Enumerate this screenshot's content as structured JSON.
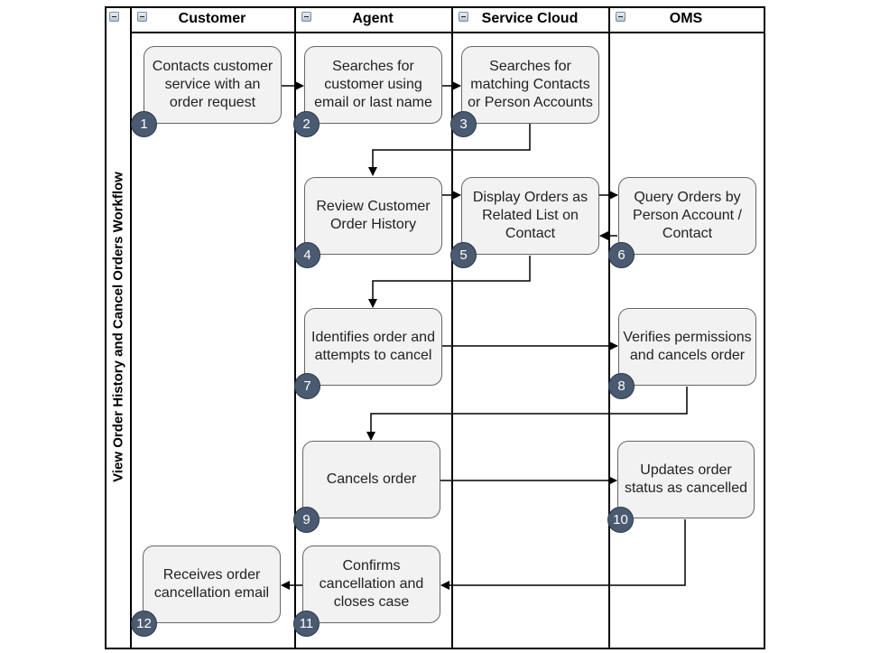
{
  "pool": {
    "title": "View Order History and Cancel Orders Workflow"
  },
  "lanes": [
    {
      "id": "customer",
      "label": "Customer"
    },
    {
      "id": "agent",
      "label": "Agent"
    },
    {
      "id": "service-cloud",
      "label": "Service Cloud"
    },
    {
      "id": "oms",
      "label": "OMS"
    }
  ],
  "tasks": [
    {
      "step": "1",
      "lane": "Customer",
      "text": "Contacts customer service with an order request"
    },
    {
      "step": "2",
      "lane": "Agent",
      "text": "Searches for customer using email or last name"
    },
    {
      "step": "3",
      "lane": "Service Cloud",
      "text": "Searches for matching Contacts or Person Accounts"
    },
    {
      "step": "4",
      "lane": "Agent",
      "text": "Review Customer Order History"
    },
    {
      "step": "5",
      "lane": "Service Cloud",
      "text": "Display Orders as Related List on Contact"
    },
    {
      "step": "6",
      "lane": "OMS",
      "text": "Query Orders by Person Account / Contact"
    },
    {
      "step": "7",
      "lane": "Agent",
      "text": "Identifies order and attempts to cancel"
    },
    {
      "step": "8",
      "lane": "OMS",
      "text": "Verifies permissions and cancels order"
    },
    {
      "step": "9",
      "lane": "Agent",
      "text": "Cancels order"
    },
    {
      "step": "10",
      "lane": "OMS",
      "text": "Updates order status as cancelled"
    },
    {
      "step": "11",
      "lane": "Agent",
      "text": "Confirms cancellation and closes case"
    },
    {
      "step": "12",
      "lane": "Customer",
      "text": "Receives order cancellation email"
    }
  ],
  "flows": [
    {
      "from": "1",
      "to": "2"
    },
    {
      "from": "2",
      "to": "3"
    },
    {
      "from": "3",
      "to": "4"
    },
    {
      "from": "4",
      "to": "5"
    },
    {
      "from": "5",
      "to": "6"
    },
    {
      "from": "6",
      "to": "5"
    },
    {
      "from": "5",
      "to": "7"
    },
    {
      "from": "7",
      "to": "8"
    },
    {
      "from": "8",
      "to": "9"
    },
    {
      "from": "9",
      "to": "10"
    },
    {
      "from": "10",
      "to": "11"
    },
    {
      "from": "11",
      "to": "12"
    }
  ],
  "colors": {
    "task_fill": "#f2f2f2",
    "task_border": "#666666",
    "badge_fill": "#4a5a70",
    "line": "#000000"
  }
}
